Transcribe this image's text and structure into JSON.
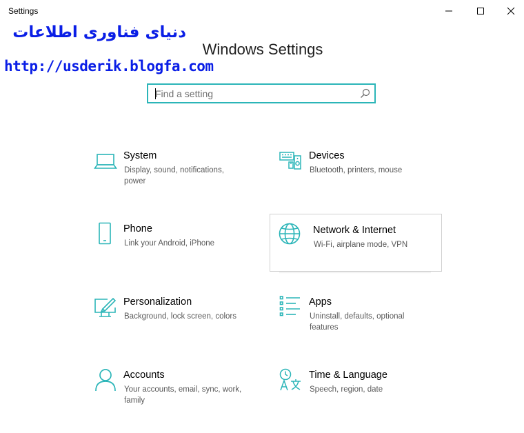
{
  "window": {
    "title": "Settings"
  },
  "watermark": {
    "persian_text": "دنیای فناوری اطلاعات",
    "url": "http://usderik.blogfa.com"
  },
  "header": {
    "title": "Windows Settings"
  },
  "search": {
    "placeholder": "Find a setting"
  },
  "colors": {
    "accent": "#2bb5b8",
    "watermark": "#0a1ee6"
  },
  "categories": [
    {
      "name": "System",
      "description": "Display, sound, notifications, power",
      "icon": "laptop-icon"
    },
    {
      "name": "Devices",
      "description": "Bluetooth, printers, mouse",
      "icon": "devices-icon"
    },
    {
      "name": "Phone",
      "description": "Link your Android, iPhone",
      "icon": "phone-icon"
    },
    {
      "name": "Network & Internet",
      "description": "Wi-Fi, airplane mode, VPN",
      "icon": "globe-icon"
    },
    {
      "name": "Personalization",
      "description": "Background, lock screen, colors",
      "icon": "paint-icon"
    },
    {
      "name": "Apps",
      "description": "Uninstall, defaults, optional features",
      "icon": "apps-list-icon"
    },
    {
      "name": "Accounts",
      "description": "Your accounts, email, sync, work, family",
      "icon": "person-icon"
    },
    {
      "name": "Time & Language",
      "description": "Speech, region, date",
      "icon": "time-language-icon"
    }
  ]
}
